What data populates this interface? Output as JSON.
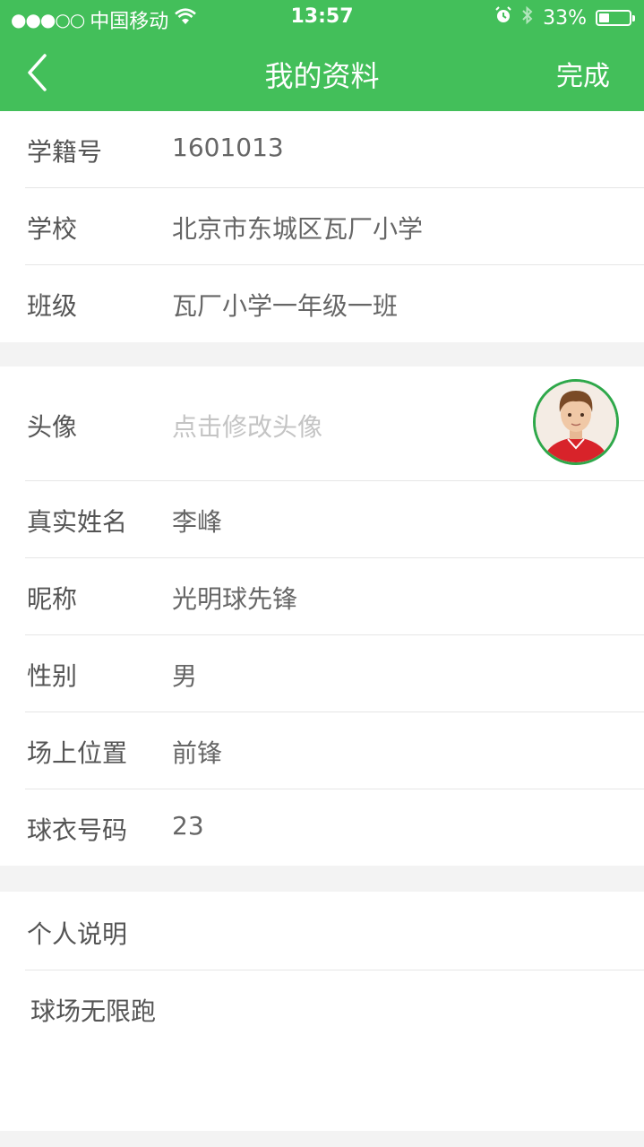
{
  "status": {
    "signal": "●●●○○",
    "carrier": "中国移动",
    "time": "13:57",
    "battery_percent": "33%",
    "battery_level": 0.33,
    "icons": [
      "wifi-icon",
      "alarm-icon",
      "bluetooth-icon",
      "battery-icon"
    ]
  },
  "nav": {
    "title": "我的资料",
    "done_label": "完成",
    "back_icon": "chevron-left-icon"
  },
  "colors": {
    "accent": "#43bf5a",
    "avatar_border": "#2ea84a"
  },
  "school_info": [
    {
      "label": "学籍号",
      "value": "1601013"
    },
    {
      "label": "学校",
      "value": "北京市东城区瓦厂小学"
    },
    {
      "label": "班级",
      "value": "瓦厂小学一年级一班"
    }
  ],
  "profile": {
    "avatar_label": "头像",
    "avatar_placeholder": "点击修改头像",
    "fields": [
      {
        "label": "真实姓名",
        "value": "李峰"
      },
      {
        "label": "昵称",
        "value": "光明球先锋"
      },
      {
        "label": "性别",
        "value": "男"
      },
      {
        "label": "场上位置",
        "value": "前锋"
      },
      {
        "label": "球衣号码",
        "value": "23"
      }
    ]
  },
  "description": {
    "title": "个人说明",
    "text": "球场无限跑"
  }
}
